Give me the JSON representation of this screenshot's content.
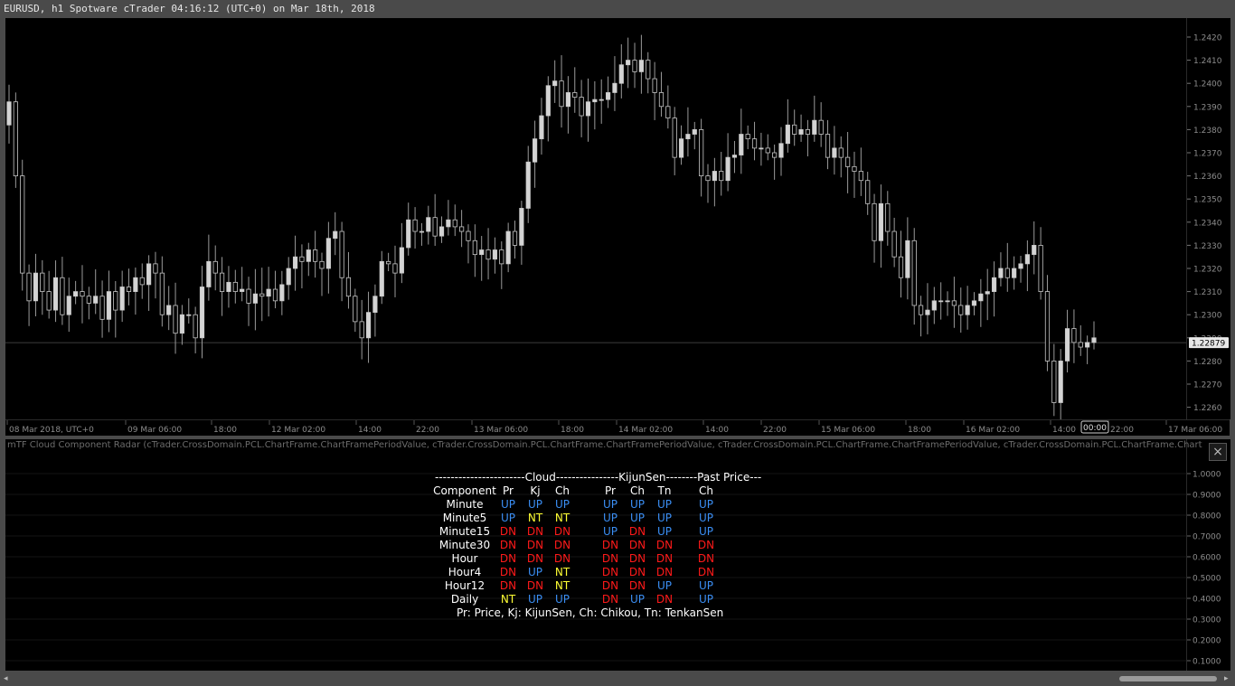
{
  "window": {
    "title": "EURUSD, h1 Spotware cTrader 04:16:12 (UTC+0) on Mar 18th, 2018"
  },
  "price_axis": {
    "labels": [
      "1.2420",
      "1.2410",
      "1.2400",
      "1.2390",
      "1.2380",
      "1.2370",
      "1.2360",
      "1.2350",
      "1.2340",
      "1.2330",
      "1.2320",
      "1.2310",
      "1.2300",
      "1.2290",
      "1.2280",
      "1.2270",
      "1.2260"
    ],
    "current_price": "1.22879"
  },
  "time_axis": {
    "labels": [
      "08 Mar 2018, UTC+0",
      "09 Mar 06:00",
      "18:00",
      "12 Mar 02:00",
      "14:00",
      "22:00",
      "13 Mar 06:00",
      "18:00",
      "14 Mar 02:00",
      "14:00",
      "22:00",
      "15 Mar 06:00",
      "18:00",
      "16 Mar 02:00",
      "14:00",
      "22:00",
      "17 Mar 06:00"
    ],
    "cursor_label": "00:00"
  },
  "indicator": {
    "header": "mTF Cloud Component Radar (cTrader.CrossDomain.PCL.ChartFrame.ChartFramePeriodValue, cTrader.CrossDomain.PCL.ChartFrame.ChartFramePeriodValue, cTrader.CrossDomain.PCL.ChartFrame.ChartFramePeriodValue, cTrader.CrossDomain.PCL.ChartFrame.ChartFramePeriodValue, cTrader.CrossDomain.PCL.ChartFrame.ChartFramePeriodValue, cTrader.Cross",
    "close_label": "×",
    "axis_labels": [
      "1.0000",
      "0.9000",
      "0.8000",
      "0.7000",
      "0.6000",
      "0.5000",
      "0.4000",
      "0.3000",
      "0.2000",
      "0.1000",
      "0.0000"
    ],
    "radar": {
      "group_header": "-----------------------Cloud----------------KijunSen--------Past Price---",
      "column_headers": [
        "Component",
        "Pr",
        "Kj",
        "Ch",
        "Pr",
        "Ch",
        "Tn",
        "Ch"
      ],
      "rows": [
        {
          "name": "Minute",
          "cells": [
            "UP",
            "UP",
            "UP",
            "UP",
            "UP",
            "UP",
            "UP"
          ]
        },
        {
          "name": "Minute5",
          "cells": [
            "UP",
            "NT",
            "NT",
            "UP",
            "UP",
            "UP",
            "UP"
          ]
        },
        {
          "name": "Minute15",
          "cells": [
            "DN",
            "DN",
            "DN",
            "UP",
            "DN",
            "UP",
            "UP"
          ]
        },
        {
          "name": "Minute30",
          "cells": [
            "DN",
            "DN",
            "DN",
            "DN",
            "DN",
            "DN",
            "DN"
          ]
        },
        {
          "name": "Hour",
          "cells": [
            "DN",
            "DN",
            "DN",
            "DN",
            "DN",
            "DN",
            "DN"
          ]
        },
        {
          "name": "Hour4",
          "cells": [
            "DN",
            "UP",
            "NT",
            "DN",
            "DN",
            "DN",
            "DN"
          ]
        },
        {
          "name": "Hour12",
          "cells": [
            "DN",
            "DN",
            "NT",
            "DN",
            "DN",
            "UP",
            "UP"
          ]
        },
        {
          "name": "Daily",
          "cells": [
            "NT",
            "UP",
            "UP",
            "DN",
            "UP",
            "DN",
            "UP"
          ]
        }
      ],
      "legend": "Pr: Price,   Kj: KijunSen,   Ch: Chikou,   Tn: TenkanSen"
    }
  },
  "scrollbar": {
    "left_arrow": "◂",
    "right_arrow": "▸"
  },
  "colors": {
    "UP": "#3b8ff5",
    "DN": "#ff1a1a",
    "NT": "#ffff33",
    "background": "#000000",
    "frame": "#4a4a4a",
    "candle": "#c8c8c8"
  },
  "chart_data": {
    "type": "candlestick",
    "symbol": "EURUSD",
    "timeframe": "h1",
    "ylim": [
      1.2255,
      1.2425
    ],
    "bid_line": 1.22879,
    "closes": [
      1.2392,
      1.236,
      1.2318,
      1.2306,
      1.2318,
      1.231,
      1.2302,
      1.2316,
      1.23,
      1.2308,
      1.231,
      1.2308,
      1.2305,
      1.2308,
      1.2298,
      1.231,
      1.2302,
      1.2312,
      1.231,
      1.2316,
      1.2313,
      1.2322,
      1.2318,
      1.23,
      1.2304,
      1.2292,
      1.23,
      1.23,
      1.229,
      1.2312,
      1.2323,
      1.2318,
      1.231,
      1.2314,
      1.231,
      1.2311,
      1.2305,
      1.2309,
      1.2308,
      1.2311,
      1.2306,
      1.2313,
      1.232,
      1.2325,
      1.2323,
      1.2328,
      1.2323,
      1.232,
      1.2333,
      1.2336,
      1.2316,
      1.2308,
      1.2297,
      1.229,
      1.2301,
      1.2308,
      1.2323,
      1.2322,
      1.2318,
      1.2329,
      1.2341,
      1.2336,
      1.2336,
      1.2342,
      1.2334,
      1.2338,
      1.2341,
      1.2338,
      1.2336,
      1.2332,
      1.2326,
      1.2328,
      1.2324,
      1.2328,
      1.2322,
      1.2336,
      1.233,
      1.2346,
      1.2366,
      1.2376,
      1.2386,
      1.2399,
      1.2401,
      1.239,
      1.2396,
      1.2394,
      1.2386,
      1.2392,
      1.2393,
      1.2393,
      1.2396,
      1.24,
      1.2408,
      1.241,
      1.2405,
      1.241,
      1.2402,
      1.2396,
      1.239,
      1.2385,
      1.2368,
      1.2376,
      1.2378,
      1.238,
      1.236,
      1.2358,
      1.2362,
      1.2358,
      1.2368,
      1.2369,
      1.2378,
      1.2376,
      1.2372,
      1.2372,
      1.237,
      1.2368,
      1.2374,
      1.2382,
      1.2378,
      1.238,
      1.2378,
      1.2384,
      1.2378,
      1.2368,
      1.2372,
      1.2368,
      1.2364,
      1.2362,
      1.2358,
      1.2348,
      1.2332,
      1.2348,
      1.2336,
      1.2325,
      1.2316,
      1.2332,
      1.2304,
      1.23,
      1.2302,
      1.2306,
      1.2306,
      1.2306,
      1.2304,
      1.23,
      1.2304,
      1.2306,
      1.2309,
      1.231,
      1.2316,
      1.232,
      1.2316,
      1.232,
      1.2322,
      1.2326,
      1.233,
      1.231,
      1.228,
      1.2262,
      1.228,
      1.2294,
      1.2288,
      1.2286,
      1.2288,
      1.229
    ]
  }
}
